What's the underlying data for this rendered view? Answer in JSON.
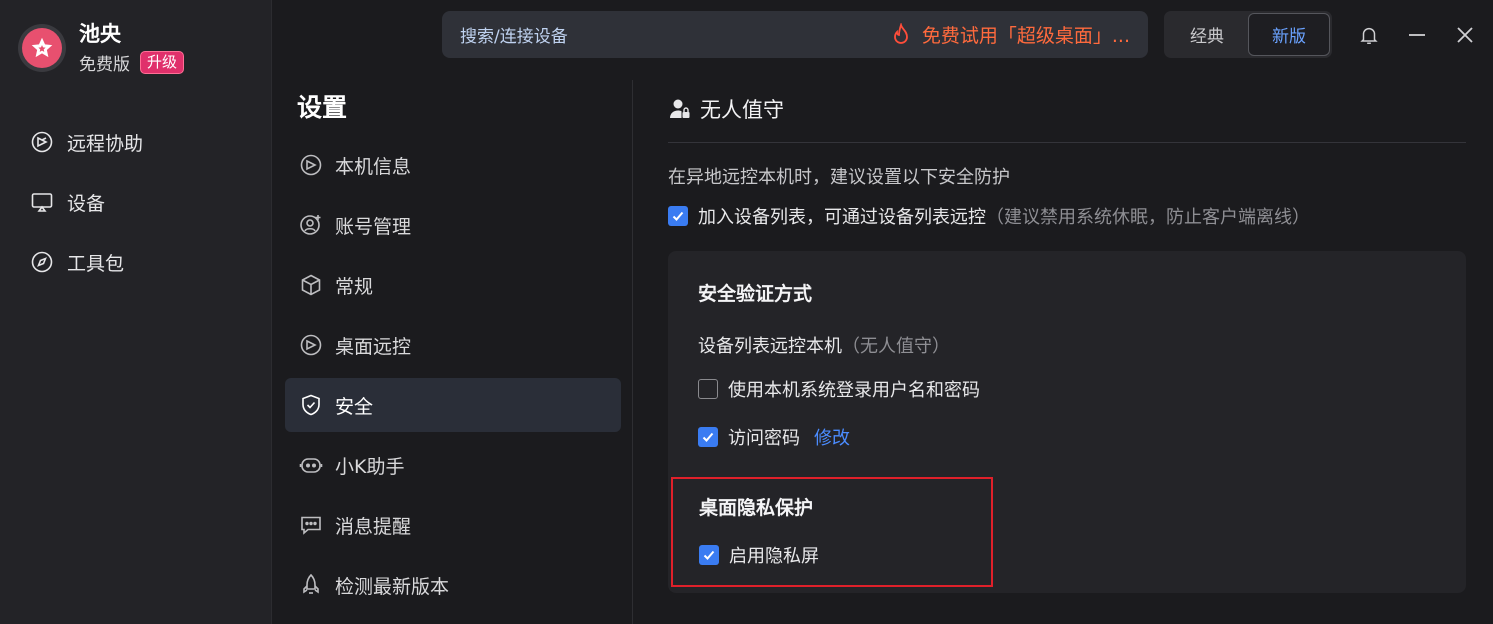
{
  "sidebar": {
    "user_name": "池央",
    "plan": "免费版",
    "upgrade": "升级",
    "items": [
      {
        "label": "远程协助",
        "icon": "remote-assist-icon"
      },
      {
        "label": "设备",
        "icon": "monitor-icon"
      },
      {
        "label": "工具包",
        "icon": "compass-icon"
      }
    ]
  },
  "topbar": {
    "search_placeholder": "搜索/连接设备",
    "promo_text": "免费试用「超级桌面」...",
    "mode_classic": "经典",
    "mode_new": "新版",
    "active_mode": "新版"
  },
  "settings": {
    "title": "设置",
    "items": [
      {
        "label": "本机信息",
        "icon": "remote-assist-icon"
      },
      {
        "label": "账号管理",
        "icon": "user-add-icon"
      },
      {
        "label": "常规",
        "icon": "cube-icon"
      },
      {
        "label": "桌面远控",
        "icon": "remote-assist-icon"
      },
      {
        "label": "安全",
        "icon": "shield-icon"
      },
      {
        "label": "小K助手",
        "icon": "robot-icon"
      },
      {
        "label": "消息提醒",
        "icon": "message-icon"
      },
      {
        "label": "检测最新版本",
        "icon": "rocket-icon"
      }
    ],
    "active": "安全"
  },
  "content": {
    "section_title": "无人值守",
    "description": "在异地远控本机时，建议设置以下安全防护",
    "add_device": {
      "label": "加入设备列表，可通过设备列表远控",
      "hint": "（建议禁用系统休眠，防止客户端离线）",
      "checked": true
    },
    "verification": {
      "heading": "安全验证方式",
      "sub_label": "设备列表远控本机",
      "sub_hint": "（无人值守）",
      "use_system_login": {
        "label": "使用本机系统登录用户名和密码",
        "checked": false
      },
      "access_password": {
        "label": "访问密码",
        "checked": true,
        "link": "修改"
      }
    },
    "privacy": {
      "heading": "桌面隐私保护",
      "enable_privacy_screen": {
        "label": "启用隐私屏",
        "checked": true
      }
    }
  },
  "colors": {
    "accent": "#3a7cf2",
    "link": "#4b8cff",
    "promo": "#ff6a3d",
    "badge": "#e0306b",
    "highlight": "#e0202a"
  }
}
